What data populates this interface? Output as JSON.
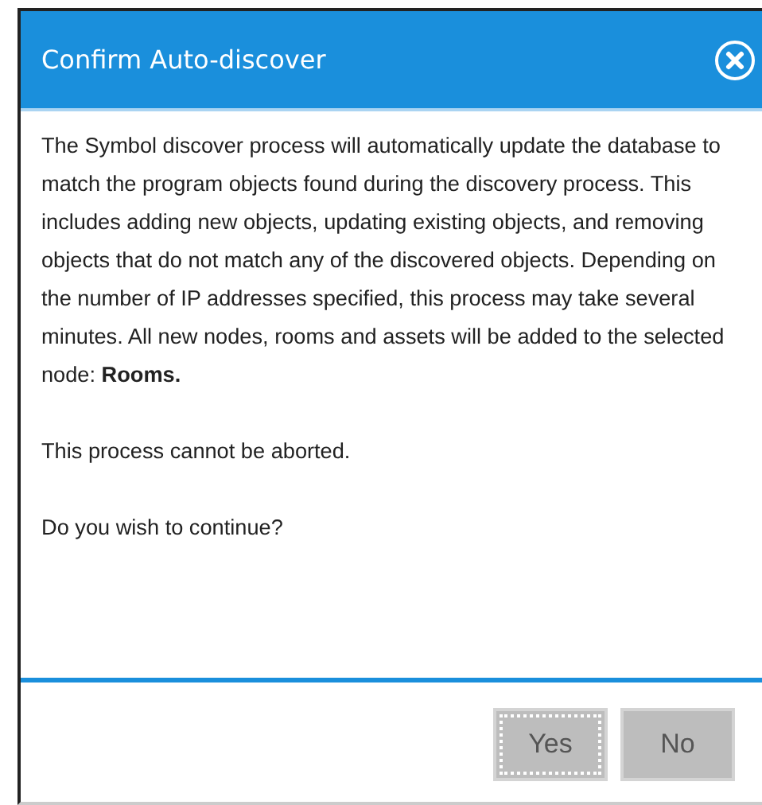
{
  "dialog": {
    "title": "Confirm Auto-discover",
    "paragraphs": [
      "The Symbol discover process will automatically update the database to match the program objects found during the discovery process. This includes adding new objects, updating existing objects, and removing objects that do not match any of the discovered objects. Depending on the number of IP addresses specified, this process may take several minutes. All new nodes, rooms and assets will be added to the selected node: **Rooms.**",
      "This process cannot be aborted.",
      "Do you wish to continue?"
    ],
    "buttons": [
      {
        "label": "Yes",
        "focused": true
      },
      {
        "label": "No",
        "focused": false
      }
    ]
  }
}
